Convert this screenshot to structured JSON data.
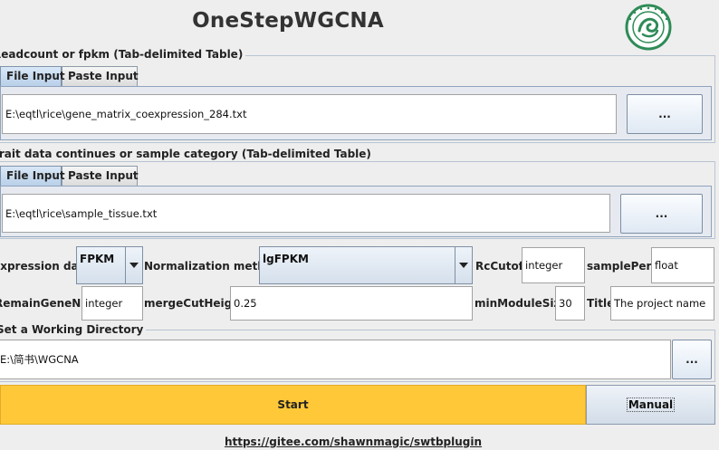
{
  "header": {
    "title": "OneStepWGCNA",
    "logo_icon": "institute-seal-logo",
    "logo_color": "#2e8b57"
  },
  "readcount": {
    "title": "Readcount or fpkm (Tab-delimited Table)",
    "tabs": [
      {
        "label": "File Input",
        "active": true
      },
      {
        "label": "Paste Input",
        "active": false
      }
    ],
    "file_path": "E:\\eqtl\\rice\\gene_matrix_coexpression_284.txt",
    "browse_label": "..."
  },
  "trait": {
    "title": "Trait data continues or sample category (Tab-delimited Table)",
    "tabs": [
      {
        "label": "File Input",
        "active": true
      },
      {
        "label": "Paste Input",
        "active": false
      }
    ],
    "file_path": "E:\\eqtl\\rice\\sample_tissue.txt",
    "browse_label": "..."
  },
  "params": {
    "expression_label": "Expression data:",
    "expression_value": "FPKM",
    "normalization_label": "Normalization method:",
    "normalization_value": "lgFPKM",
    "rccutoff_label": "RcCutoff:",
    "rccutoff_value": "integer",
    "sampleperc_label": "samplePerc:",
    "sampleperc_value": "float",
    "remaingenenum_label": "RemainGeneNum:",
    "remaingenenum_value": "integer",
    "mergecutheight_label": "mergeCutHeight:",
    "mergecutheight_value": "0.25",
    "minmodulesize_label": "minModuleSize:",
    "minmodulesize_value": "30",
    "title_label": "Title:",
    "title_value": "The project name"
  },
  "workdir": {
    "title": "Set a Working Directory",
    "path": "E:\\简书\\WGCNA",
    "browse_label": "..."
  },
  "actions": {
    "start_label": "Start",
    "manual_label": "Manual",
    "start_color": "#ffc838"
  },
  "footer": {
    "link": "https://gitee.com/shawnmagic/swtbplugin"
  }
}
